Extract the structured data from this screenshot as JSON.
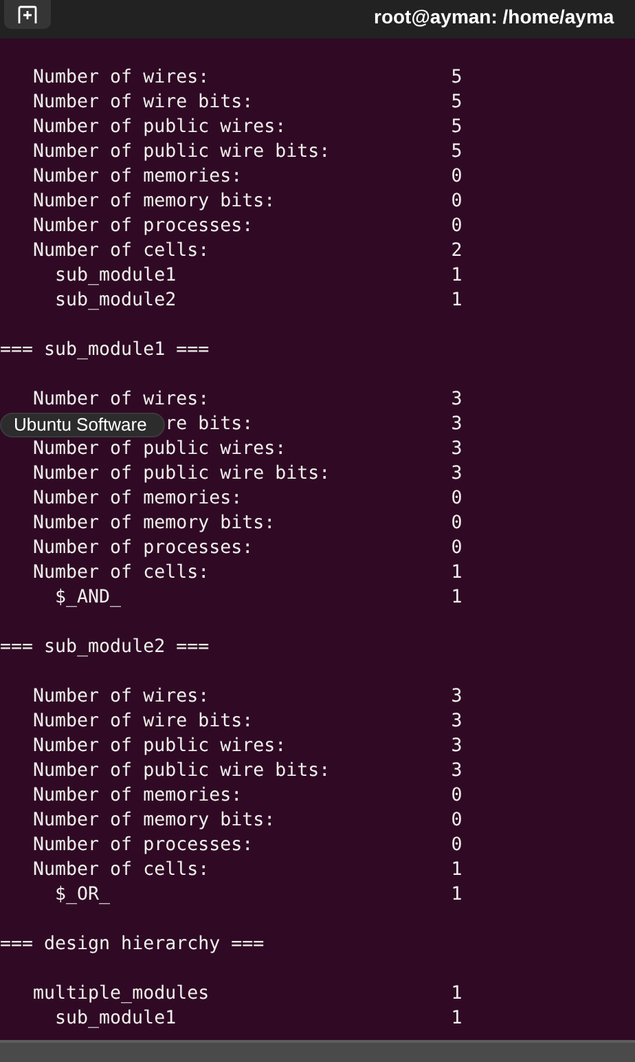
{
  "window": {
    "title": "root@ayman: /home/ayma"
  },
  "terminal": {
    "blocks": [
      {
        "rows": [
          {
            "label": "Number of wires:",
            "value": "5"
          },
          {
            "label": "Number of wire bits:",
            "value": "5"
          },
          {
            "label": "Number of public wires:",
            "value": "5"
          },
          {
            "label": "Number of public wire bits:",
            "value": "5"
          },
          {
            "label": "Number of memories:",
            "value": "0"
          },
          {
            "label": "Number of memory bits:",
            "value": "0"
          },
          {
            "label": "Number of processes:",
            "value": "0"
          },
          {
            "label": "Number of cells:",
            "value": "2",
            "children": [
              {
                "label": "sub_module1",
                "value": "1"
              },
              {
                "label": "sub_module2",
                "value": "1"
              }
            ]
          }
        ]
      },
      {
        "heading": "=== sub_module1 ===",
        "rows": [
          {
            "label": "Number of wires:",
            "value": "3"
          },
          {
            "label": "re bits:",
            "covered": true,
            "value": "3"
          },
          {
            "label": "Number of public wires:",
            "value": "3"
          },
          {
            "label": "Number of public wire bits:",
            "value": "3"
          },
          {
            "label": "Number of memories:",
            "value": "0"
          },
          {
            "label": "Number of memory bits:",
            "value": "0"
          },
          {
            "label": "Number of processes:",
            "value": "0"
          },
          {
            "label": "Number of cells:",
            "value": "1",
            "children": [
              {
                "label": "$_AND_",
                "value": "1"
              }
            ]
          }
        ]
      },
      {
        "heading": "=== sub_module2 ===",
        "rows": [
          {
            "label": "Number of wires:",
            "value": "3"
          },
          {
            "label": "Number of wire bits:",
            "value": "3"
          },
          {
            "label": "Number of public wires:",
            "value": "3"
          },
          {
            "label": "Number of public wire bits:",
            "value": "3"
          },
          {
            "label": "Number of memories:",
            "value": "0"
          },
          {
            "label": "Number of memory bits:",
            "value": "0"
          },
          {
            "label": "Number of processes:",
            "value": "0"
          },
          {
            "label": "Number of cells:",
            "value": "1",
            "children": [
              {
                "label": "$_OR_",
                "value": "1"
              }
            ]
          }
        ]
      },
      {
        "heading": "=== design hierarchy ===",
        "rows": [
          {
            "label": "multiple_modules",
            "value": "1",
            "children": [
              {
                "label": "sub_module1",
                "value": "1"
              }
            ]
          }
        ]
      }
    ]
  },
  "tooltip": {
    "text": "Ubuntu Software"
  }
}
